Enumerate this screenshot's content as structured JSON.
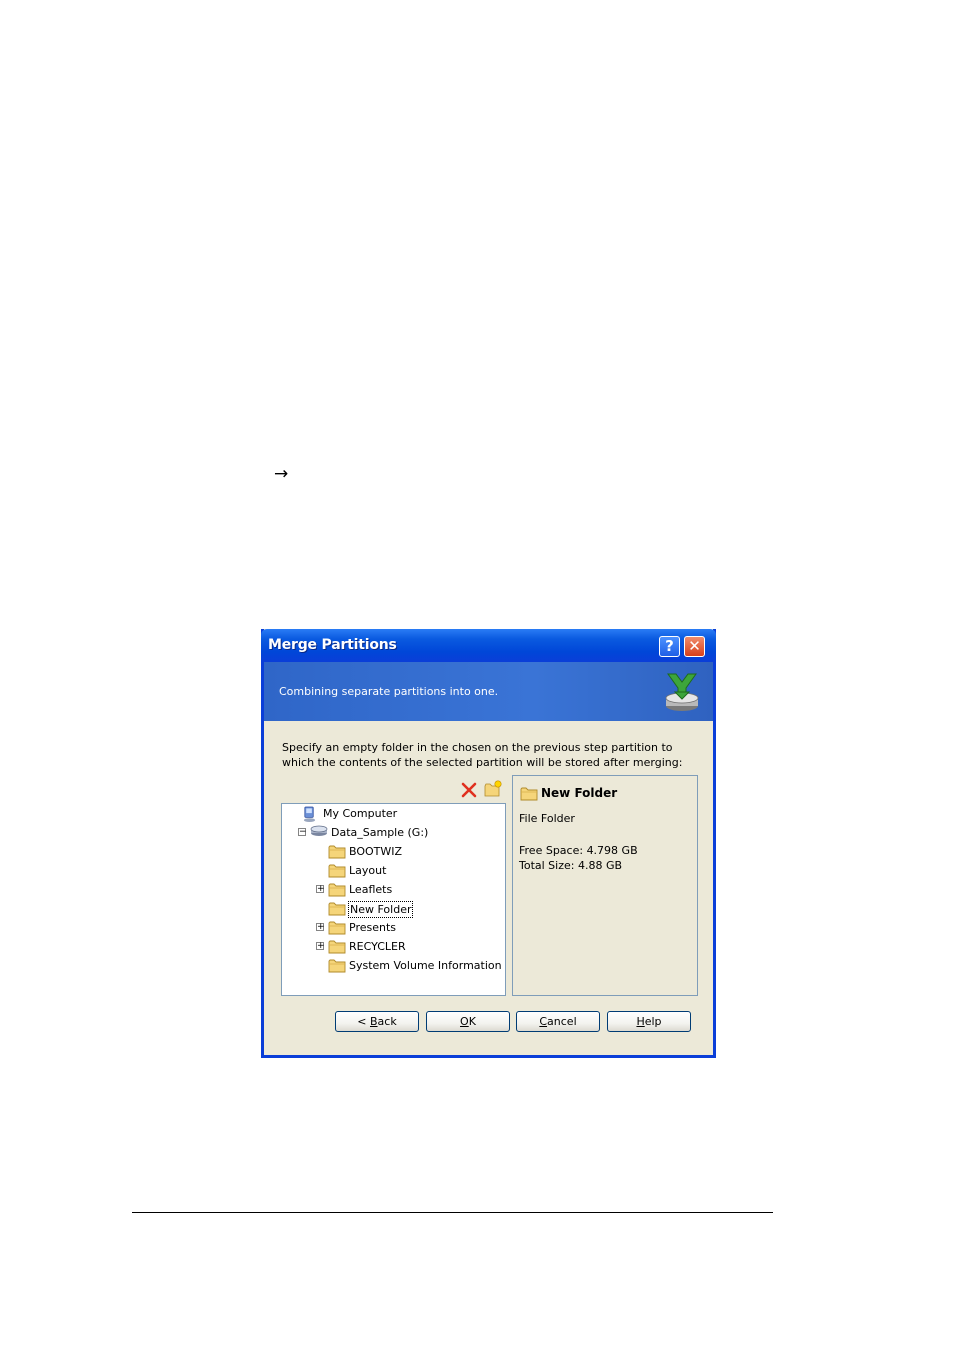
{
  "page": {
    "arrow_glyph": "→"
  },
  "dialog": {
    "title": "Merge Partitions",
    "help_button": "?",
    "close_button": "✕",
    "header_text": "Combining separate partitions into one.",
    "instruction": "Specify an empty folder in the chosen on the previous step partition to which the contents of the selected partition will be stored after merging:",
    "toolbar": {
      "delete_icon": "delete-icon",
      "new_folder_icon": "new-folder-icon"
    },
    "tree": [
      {
        "label": "My Computer",
        "icon": "computer-icon",
        "level": 0,
        "expander": ""
      },
      {
        "label": "Data_Sample (G:)",
        "icon": "drive-icon",
        "level": 1,
        "expander": "−"
      },
      {
        "label": "BOOTWIZ",
        "icon": "folder-icon",
        "level": 2,
        "expander": ""
      },
      {
        "label": "Layout",
        "icon": "folder-icon",
        "level": 2,
        "expander": ""
      },
      {
        "label": "Leaflets",
        "icon": "folder-icon",
        "level": 2,
        "expander": "+"
      },
      {
        "label": "New Folder",
        "icon": "folder-icon",
        "level": 2,
        "expander": "",
        "selected": true
      },
      {
        "label": "Presents",
        "icon": "folder-icon",
        "level": 2,
        "expander": "+"
      },
      {
        "label": "RECYCLER",
        "icon": "folder-icon",
        "level": 2,
        "expander": "+"
      },
      {
        "label": "System Volume Information",
        "icon": "folder-icon",
        "level": 2,
        "expander": ""
      }
    ],
    "info": {
      "name": "New Folder",
      "type": "File Folder",
      "free_space": "Free Space: 4.798 GB",
      "total_size": "Total Size: 4.88 GB"
    },
    "buttons": {
      "back": {
        "prefix": "< ",
        "mnemonic": "B",
        "rest": "ack"
      },
      "ok": {
        "prefix": "",
        "mnemonic": "O",
        "rest": "K"
      },
      "cancel": {
        "prefix": "",
        "mnemonic": "C",
        "rest": "ancel"
      },
      "help": {
        "prefix": "",
        "mnemonic": "H",
        "rest": "elp"
      }
    }
  },
  "colors": {
    "titlebar": "#0a5ae0",
    "header": "#3a74d6",
    "dialog_bg": "#ece9d8",
    "folder": "#f5d57a"
  }
}
